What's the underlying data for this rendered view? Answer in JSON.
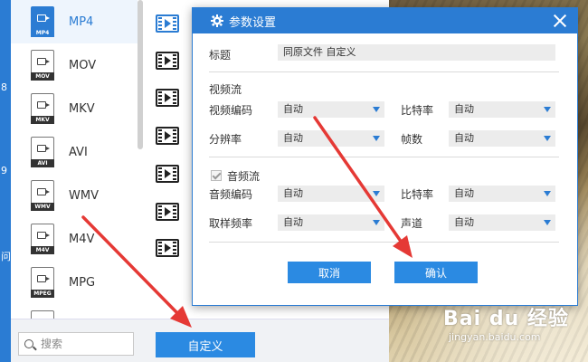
{
  "format_list": {
    "items": [
      {
        "label": "MP4",
        "tag": "MP4",
        "active": true
      },
      {
        "label": "MOV",
        "tag": "MOV"
      },
      {
        "label": "MKV",
        "tag": "MKV"
      },
      {
        "label": "AVI",
        "tag": "AVI"
      },
      {
        "label": "WMV",
        "tag": "WMV"
      },
      {
        "label": "M4V",
        "tag": "M4V"
      },
      {
        "label": "MPG",
        "tag": "MPEG"
      }
    ]
  },
  "left_edge_chars": [
    "8",
    "9",
    "问"
  ],
  "bottom_bar": {
    "search_placeholder": "搜索",
    "custom_button": "自定义"
  },
  "dialog": {
    "title": "参数设置",
    "title_label": "标题",
    "title_value": "同原文件 自定义",
    "video_section": "视频流",
    "video_codec_label": "视频编码",
    "video_codec_value": "自动",
    "video_bitrate_label": "比特率",
    "video_bitrate_value": "自动",
    "resolution_label": "分辨率",
    "resolution_value": "自动",
    "framerate_label": "帧数",
    "framerate_value": "自动",
    "audio_section": "音频流",
    "audio_codec_label": "音频编码",
    "audio_codec_value": "自动",
    "audio_bitrate_label": "比特率",
    "audio_bitrate_value": "自动",
    "samplerate_label": "取样频率",
    "samplerate_value": "自动",
    "channel_label": "声道",
    "channel_value": "自动",
    "cancel": "取消",
    "confirm": "确认"
  },
  "watermark": {
    "main": "Bai du 经验",
    "sub": "jingyan.baidu.com"
  },
  "colors": {
    "accent": "#2b7cd3",
    "button": "#2b8ae2",
    "annotation": "#e53935"
  }
}
